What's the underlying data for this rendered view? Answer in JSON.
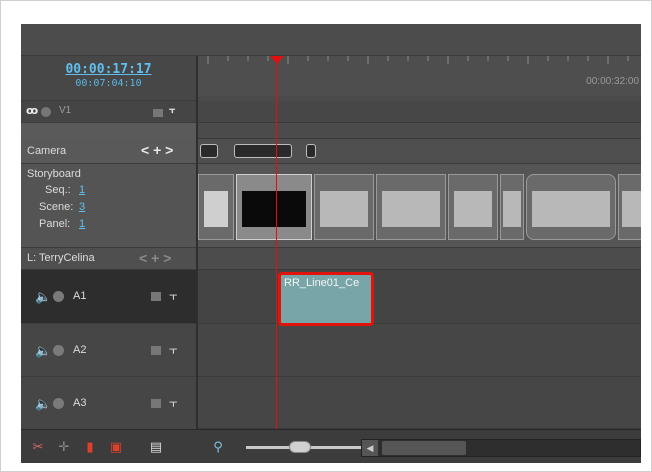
{
  "timecode": {
    "main": "00:00:17:17",
    "sub": "00:07:04:10"
  },
  "ruler": {
    "label": "00:00:32:00"
  },
  "tracks": {
    "v1": {
      "label": "V1"
    },
    "camera": {
      "label": "Camera",
      "controls": "< + >"
    },
    "storyboard": {
      "title": "Storyboard",
      "seq_label": "Seq.:",
      "seq_value": "1",
      "scene_label": "Scene:",
      "scene_value": "3",
      "panel_label": "Panel:",
      "panel_value": "1"
    },
    "layer": {
      "label": "L: TerryCelina",
      "controls": "< + >"
    },
    "audio": [
      {
        "label": "A1"
      },
      {
        "label": "A2"
      },
      {
        "label": "A3"
      }
    ]
  },
  "clip": {
    "label": "RR_Line01_Ce"
  },
  "colors": {
    "playhead": "#e01010",
    "clip": "#78a6a8",
    "highlight": "#e0140b",
    "timecode": "#5fc0f0"
  },
  "icons": [
    "speaker-icon",
    "mute-dot-icon",
    "lock-icon",
    "link-icon",
    "zoom-icon",
    "split-icon",
    "add-marker-icon",
    "insert-icon",
    "delete-icon",
    "menu-icon"
  ]
}
